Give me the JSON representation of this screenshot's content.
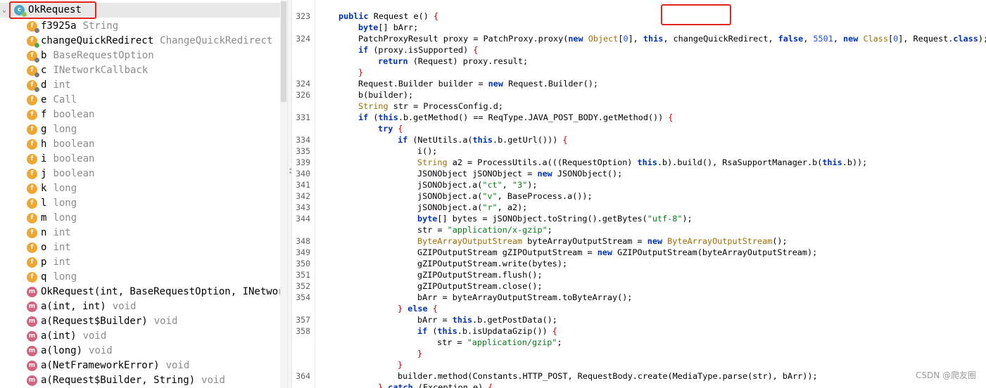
{
  "structure": {
    "root": {
      "name": "OkRequest"
    },
    "items": [
      {
        "name": "f3925a",
        "type": "String",
        "kind": "field",
        "badge": "lock"
      },
      {
        "name": "changeQuickRedirect",
        "type": "ChangeQuickRedirect",
        "kind": "field",
        "badge": "pub"
      },
      {
        "name": "b",
        "type": "BaseRequestOption",
        "kind": "field",
        "badge": "lock"
      },
      {
        "name": "c",
        "type": "INetworkCallback",
        "kind": "field",
        "badge": "lock"
      },
      {
        "name": "d",
        "type": "int",
        "kind": "field",
        "badge": "lock"
      },
      {
        "name": "e",
        "type": "Call",
        "kind": "field",
        "badge": ""
      },
      {
        "name": "f",
        "type": "boolean",
        "kind": "field",
        "badge": ""
      },
      {
        "name": "g",
        "type": "long",
        "kind": "field",
        "badge": ""
      },
      {
        "name": "h",
        "type": "boolean",
        "kind": "field",
        "badge": ""
      },
      {
        "name": "i",
        "type": "boolean",
        "kind": "field",
        "badge": ""
      },
      {
        "name": "j",
        "type": "boolean",
        "kind": "field",
        "badge": ""
      },
      {
        "name": "k",
        "type": "long",
        "kind": "field",
        "badge": ""
      },
      {
        "name": "l",
        "type": "long",
        "kind": "field",
        "badge": ""
      },
      {
        "name": "m",
        "type": "long",
        "kind": "field",
        "badge": ""
      },
      {
        "name": "n",
        "type": "int",
        "kind": "field",
        "badge": ""
      },
      {
        "name": "o",
        "type": "int",
        "kind": "field",
        "badge": ""
      },
      {
        "name": "p",
        "type": "int",
        "kind": "field",
        "badge": ""
      },
      {
        "name": "q",
        "type": "long",
        "kind": "field",
        "badge": ""
      },
      {
        "name": "OkRequest(int, BaseRequestOption, INetworkC",
        "type": "",
        "kind": "method",
        "badge": ""
      },
      {
        "name": "a(int, int)",
        "type": "void",
        "kind": "method",
        "badge": ""
      },
      {
        "name": "a(Request$Builder)",
        "type": "void",
        "kind": "method",
        "badge": ""
      },
      {
        "name": "a(int)",
        "type": "void",
        "kind": "method",
        "badge": ""
      },
      {
        "name": "a(long)",
        "type": "void",
        "kind": "method",
        "badge": ""
      },
      {
        "name": "a(NetFrameworkError)",
        "type": "void",
        "kind": "method",
        "badge": ""
      },
      {
        "name": "a(Request$Builder, String)",
        "type": "void",
        "kind": "method",
        "badge": ""
      }
    ]
  },
  "code": {
    "lines": [
      {
        "n": "323",
        "indent": 1,
        "tokens": [
          [
            "kw",
            "public "
          ],
          [
            "",
            "Request e() "
          ],
          [
            "br",
            "{"
          ]
        ]
      },
      {
        "n": "",
        "indent": 2,
        "tokens": [
          [
            "kw",
            "byte"
          ],
          [
            "",
            "[] bArr;"
          ]
        ]
      },
      {
        "n": "324",
        "indent": 2,
        "tokens": [
          [
            "",
            "PatchProxyResult proxy = PatchProxy.proxy("
          ],
          [
            "kw",
            "new "
          ],
          [
            "ty2",
            "Object"
          ],
          [
            "",
            "["
          ],
          [
            "nu",
            "0"
          ],
          [
            "",
            "], "
          ],
          [
            "kw",
            "this"
          ],
          [
            "",
            ", changeQuickRedirect, "
          ],
          [
            "kw",
            "false"
          ],
          [
            "",
            ", "
          ],
          [
            "nu",
            "5501"
          ],
          [
            "",
            ", "
          ],
          [
            "kw",
            "new "
          ],
          [
            "ty2",
            "Class"
          ],
          [
            "",
            "["
          ],
          [
            "nu",
            "0"
          ],
          [
            "",
            "], Request."
          ],
          [
            "kw",
            "class"
          ],
          [
            "",
            ");"
          ]
        ]
      },
      {
        "n": "",
        "indent": 2,
        "tokens": [
          [
            "kw",
            "if "
          ],
          [
            "",
            "(proxy.isSupported) "
          ],
          [
            "br",
            "{"
          ]
        ]
      },
      {
        "n": "",
        "indent": 3,
        "tokens": [
          [
            "kw",
            "return "
          ],
          [
            "",
            "(Request) proxy.result;"
          ]
        ]
      },
      {
        "n": "",
        "indent": 2,
        "tokens": [
          [
            "br",
            "}"
          ]
        ]
      },
      {
        "n": "324",
        "indent": 2,
        "tokens": [
          [
            "",
            "Request.Builder builder = "
          ],
          [
            "kw",
            "new "
          ],
          [
            "",
            "Request.Builder();"
          ]
        ]
      },
      {
        "n": "326",
        "indent": 2,
        "tokens": [
          [
            "",
            "b(builder);"
          ]
        ]
      },
      {
        "n": "",
        "indent": 2,
        "tokens": [
          [
            "ty2",
            "String "
          ],
          [
            "",
            "str = ProcessConfig.d;"
          ]
        ]
      },
      {
        "n": "331",
        "indent": 2,
        "tokens": [
          [
            "kw",
            "if "
          ],
          [
            "",
            "("
          ],
          [
            "kw",
            "this"
          ],
          [
            "",
            ".b.getMethod() == ReqType.JAVA_POST_BODY.getMethod()) "
          ],
          [
            "br",
            "{"
          ]
        ]
      },
      {
        "n": "",
        "indent": 3,
        "tokens": [
          [
            "kw",
            "try "
          ],
          [
            "br",
            "{"
          ]
        ]
      },
      {
        "n": "334",
        "indent": 4,
        "tokens": [
          [
            "kw",
            "if "
          ],
          [
            "",
            "(NetUtils.a("
          ],
          [
            "kw",
            "this"
          ],
          [
            "",
            ".b.getUrl())) "
          ],
          [
            "br",
            "{"
          ]
        ]
      },
      {
        "n": "335",
        "indent": 5,
        "tokens": [
          [
            "",
            "i();"
          ]
        ]
      },
      {
        "n": "339",
        "indent": 5,
        "tokens": [
          [
            "ty2",
            "String "
          ],
          [
            "",
            "a2 = ProcessUtils.a(((RequestOption) "
          ],
          [
            "kw",
            "this"
          ],
          [
            "",
            ".b).build(), RsaSupportManager.b("
          ],
          [
            "kw",
            "this"
          ],
          [
            "",
            ".b));"
          ]
        ]
      },
      {
        "n": "340",
        "indent": 5,
        "tokens": [
          [
            "",
            "JSONObject jSONObject = "
          ],
          [
            "kw",
            "new "
          ],
          [
            "",
            "JSONObject();"
          ]
        ]
      },
      {
        "n": "341",
        "indent": 5,
        "tokens": [
          [
            "",
            "jSONObject.a("
          ],
          [
            "st",
            "\"ct\""
          ],
          [
            "",
            ", "
          ],
          [
            "st",
            "\"3\""
          ],
          [
            "",
            ");"
          ]
        ]
      },
      {
        "n": "342",
        "indent": 5,
        "tokens": [
          [
            "",
            "jSONObject.a("
          ],
          [
            "st",
            "\"v\""
          ],
          [
            "",
            ", BaseProcess.a());"
          ]
        ]
      },
      {
        "n": "343",
        "indent": 5,
        "tokens": [
          [
            "",
            "jSONObject.a("
          ],
          [
            "st",
            "\"r\""
          ],
          [
            "",
            ", a2);"
          ]
        ]
      },
      {
        "n": "344",
        "indent": 5,
        "tokens": [
          [
            "kw",
            "byte"
          ],
          [
            "",
            "[] bytes = jSONObject.toString().getBytes("
          ],
          [
            "st",
            "\"utf-8\""
          ],
          [
            "",
            ");"
          ]
        ]
      },
      {
        "n": "",
        "indent": 5,
        "tokens": [
          [
            "",
            "str = "
          ],
          [
            "st",
            "\"application/x-gzip\""
          ],
          [
            "",
            ";"
          ]
        ]
      },
      {
        "n": "348",
        "indent": 5,
        "tokens": [
          [
            "ty2",
            "ByteArrayOutputStream "
          ],
          [
            "",
            "byteArrayOutputStream = "
          ],
          [
            "kw",
            "new "
          ],
          [
            "ty2",
            "ByteArrayOutputStream"
          ],
          [
            "",
            "();"
          ]
        ]
      },
      {
        "n": "349",
        "indent": 5,
        "tokens": [
          [
            "",
            "GZIPOutputStream gZIPOutputStream = "
          ],
          [
            "kw",
            "new "
          ],
          [
            "",
            "GZIPOutputStream(byteArrayOutputStream);"
          ]
        ]
      },
      {
        "n": "350",
        "indent": 5,
        "tokens": [
          [
            "",
            "gZIPOutputStream.write(bytes);"
          ]
        ]
      },
      {
        "n": "351",
        "indent": 5,
        "tokens": [
          [
            "",
            "gZIPOutputStream.flush();"
          ]
        ]
      },
      {
        "n": "352",
        "indent": 5,
        "tokens": [
          [
            "",
            "gZIPOutputStream.close();"
          ]
        ]
      },
      {
        "n": "354",
        "indent": 5,
        "tokens": [
          [
            "",
            "bArr = byteArrayOutputStream.toByteArray();"
          ]
        ]
      },
      {
        "n": "",
        "indent": 4,
        "tokens": [
          [
            "br",
            "} "
          ],
          [
            "kw",
            "else "
          ],
          [
            "br",
            "{"
          ]
        ]
      },
      {
        "n": "357",
        "indent": 5,
        "tokens": [
          [
            "",
            "bArr = "
          ],
          [
            "kw",
            "this"
          ],
          [
            "",
            ".b.getPostData();"
          ]
        ]
      },
      {
        "n": "358",
        "indent": 5,
        "tokens": [
          [
            "kw",
            "if "
          ],
          [
            "",
            "("
          ],
          [
            "kw",
            "this"
          ],
          [
            "",
            ".b.isUpdataGzip()) "
          ],
          [
            "br",
            "{"
          ]
        ]
      },
      {
        "n": "",
        "indent": 6,
        "tokens": [
          [
            "",
            "str = "
          ],
          [
            "st",
            "\"application/gzip\""
          ],
          [
            "",
            ";"
          ]
        ]
      },
      {
        "n": "",
        "indent": 5,
        "tokens": [
          [
            "br",
            "}"
          ]
        ]
      },
      {
        "n": "",
        "indent": 4,
        "tokens": [
          [
            "br",
            "}"
          ]
        ]
      },
      {
        "n": "364",
        "indent": 4,
        "tokens": [
          [
            "",
            "builder.method(Constants.HTTP_POST, RequestBody.create(MediaType.parse(str), bArr));"
          ]
        ]
      },
      {
        "n": "",
        "indent": 3,
        "tokens": [
          [
            "br",
            "} "
          ],
          [
            "kw",
            "catch "
          ],
          [
            "",
            "(Exception e) "
          ],
          [
            "br",
            "{"
          ]
        ]
      }
    ]
  },
  "watermark": "CSDN @爬友圈"
}
